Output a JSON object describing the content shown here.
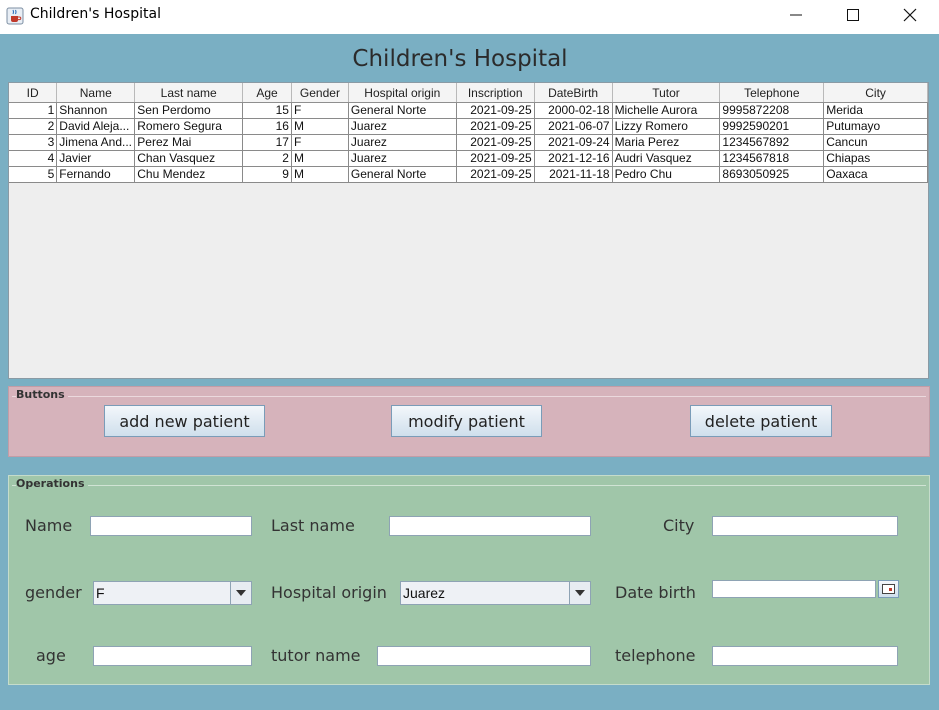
{
  "window": {
    "title": "Children's Hospital",
    "icon": "java-cup-icon",
    "controls": [
      "minimize-icon",
      "maximize-icon",
      "close-icon"
    ]
  },
  "header": {
    "title": "Children's Hospital"
  },
  "table": {
    "columns": [
      "ID",
      "Name",
      "Last name",
      "Age",
      "Gender",
      "Hospital origin",
      "Inscription",
      "DateBirth",
      "Tutor",
      "Telephone",
      "City"
    ],
    "rows": [
      [
        "1",
        "Shannon",
        "Sen Perdomo",
        "15",
        "F",
        "General Norte",
        "2021-09-25",
        "2000-02-18",
        "Michelle Aurora",
        "9995872208",
        "Merida"
      ],
      [
        "2",
        "David Aleja...",
        "Romero Segura",
        "16",
        "M",
        "Juarez",
        "2021-09-25",
        "2021-06-07",
        "Lizzy Romero",
        "9992590201",
        "Putumayo"
      ],
      [
        "3",
        "Jimena And...",
        "Perez Mai",
        "17",
        "F",
        "Juarez",
        "2021-09-25",
        "2021-09-24",
        "Maria Perez",
        "1234567892",
        "Cancun"
      ],
      [
        "4",
        "Javier",
        "Chan Vasquez",
        "2",
        "M",
        "Juarez",
        "2021-09-25",
        "2021-12-16",
        "Audri Vasquez",
        "1234567818",
        "Chiapas"
      ],
      [
        "5",
        "Fernando",
        "Chu Mendez",
        "9",
        "M",
        "General Norte",
        "2021-09-25",
        "2021-11-18",
        "Pedro Chu",
        "8693050925",
        "Oaxaca"
      ]
    ]
  },
  "buttons_panel": {
    "title": "Buttons",
    "add_label": "add new patient",
    "modify_label": "modify patient",
    "delete_label": "delete patient"
  },
  "operations": {
    "title": "Operations",
    "name_label": "Name",
    "last_name_label": "Last name",
    "city_label": "City",
    "gender_label": "gender",
    "gender_value": "F",
    "hospital_label": "Hospital origin",
    "hospital_value": "Juarez",
    "date_birth_label": "Date birth",
    "age_label": "age",
    "tutor_label": "tutor name",
    "telephone_label": "telephone",
    "name_value": "",
    "last_name_value": "",
    "city_value": "",
    "date_birth_value": "",
    "age_value": "",
    "tutor_value": "",
    "telephone_value": ""
  },
  "colors": {
    "window_bg": "#7aafc3",
    "buttons_panel_bg": "#d6b3bb",
    "operations_panel_bg": "#a0c6a9"
  }
}
